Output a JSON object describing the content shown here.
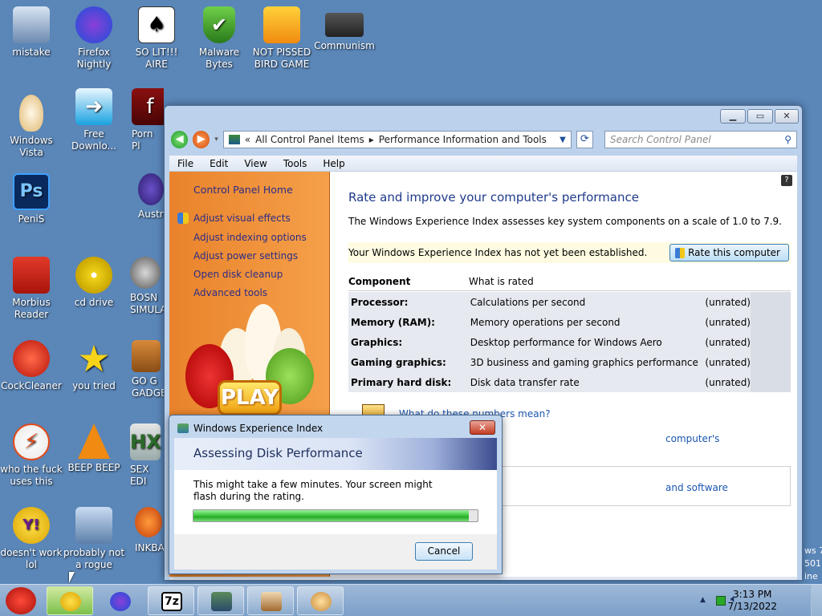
{
  "desktop": {
    "icons": [
      {
        "label": "mistake"
      },
      {
        "label": "Firefox Nightly"
      },
      {
        "label": "SO LIT!!! AIRE"
      },
      {
        "label": "Malware Bytes"
      },
      {
        "label": "NOT PISSED BIRD GAME"
      },
      {
        "label": "Communism"
      },
      {
        "label": "Windows Vista"
      },
      {
        "label": "Free Downlo..."
      },
      {
        "label": "Porn Pl"
      },
      {
        "label": "PeniS"
      },
      {
        "label": "Austra"
      },
      {
        "label": "Morbius Reader"
      },
      {
        "label": "cd drive"
      },
      {
        "label": "BOSN SIMULA"
      },
      {
        "label": "CockCleaner"
      },
      {
        "label": "you tried"
      },
      {
        "label": "GO G GADGE"
      },
      {
        "label": "who the fuck uses this"
      },
      {
        "label": "BEEP BEEP"
      },
      {
        "label": "SEX EDI"
      },
      {
        "label": "doesn't work lol"
      },
      {
        "label": "probably not a rogue"
      },
      {
        "label": "INKBA"
      }
    ],
    "partial_text": "ws 7\n501\nine"
  },
  "control_panel": {
    "address": {
      "prefix": "«",
      "part1": "All Control Panel Items",
      "sep": "▸",
      "part2": "Performance Information and Tools"
    },
    "search_placeholder": "Search Control Panel",
    "menu": [
      "File",
      "Edit",
      "View",
      "Tools",
      "Help"
    ],
    "left_links": [
      "Control Panel Home",
      "Adjust visual effects",
      "Adjust indexing options",
      "Adjust power settings",
      "Open disk cleanup",
      "Advanced tools"
    ],
    "title": "Rate and improve your computer's performance",
    "description": "The Windows Experience Index assesses key system components on a scale of 1.0 to 7.9.",
    "wei_notice": "Your Windows Experience Index has not yet been established.",
    "rate_button": "Rate this computer",
    "table": {
      "headers": [
        "Component",
        "What is rated"
      ],
      "rows": [
        {
          "component": "Processor:",
          "rated": "Calculations per second",
          "score": "(unrated)"
        },
        {
          "component": "Memory (RAM):",
          "rated": "Memory operations per second",
          "score": "(unrated)"
        },
        {
          "component": "Graphics:",
          "rated": "Desktop performance for Windows Aero",
          "score": "(unrated)"
        },
        {
          "component": "Gaming graphics:",
          "rated": "3D business and gaming graphics performance",
          "score": "(unrated)"
        },
        {
          "component": "Primary hard disk:",
          "rated": "Disk data transfer rate",
          "score": "(unrated)"
        }
      ]
    },
    "link_numbers": "What do these numbers mean?",
    "link_computer": "computer's",
    "link_software": "and software",
    "play_label": "PLAY"
  },
  "wei_dialog": {
    "title": "Windows Experience Index",
    "heading": "Assessing Disk Performance",
    "message": "This might take a few minutes. Your screen might flash during the rating.",
    "progress": 0.97,
    "cancel": "Cancel"
  },
  "taskbar": {
    "time": "3:13 PM",
    "date": "7/13/2022",
    "tray_arrow": "▲"
  },
  "colors": {
    "desktop": "#5a86b8",
    "leftpane": "#f09140",
    "link": "#2c2c86",
    "progress": "#35c335"
  }
}
